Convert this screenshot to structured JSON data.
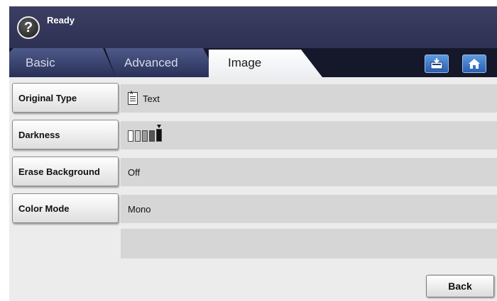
{
  "status": {
    "text": "Ready",
    "help_symbol": "?"
  },
  "tabs": [
    {
      "label": "Basic",
      "active": false
    },
    {
      "label": "Advanced",
      "active": false
    },
    {
      "label": "Image",
      "active": true
    }
  ],
  "toolbar": {
    "tray_icon": "tray-icon",
    "home_icon": "home-icon"
  },
  "settings": [
    {
      "label": "Original Type",
      "value": "Text",
      "icon": "document-icon"
    },
    {
      "label": "Darkness",
      "value": "",
      "level": 5,
      "levels": 5
    },
    {
      "label": "Erase Background",
      "value": "Off"
    },
    {
      "label": "Color Mode",
      "value": "Mono"
    }
  ],
  "back_label": "Back",
  "colors": {
    "topbar": "#2e3152",
    "tab_active": "#ffffff",
    "accent_button": "#2b5fb0",
    "content_bg": "#ececec"
  }
}
